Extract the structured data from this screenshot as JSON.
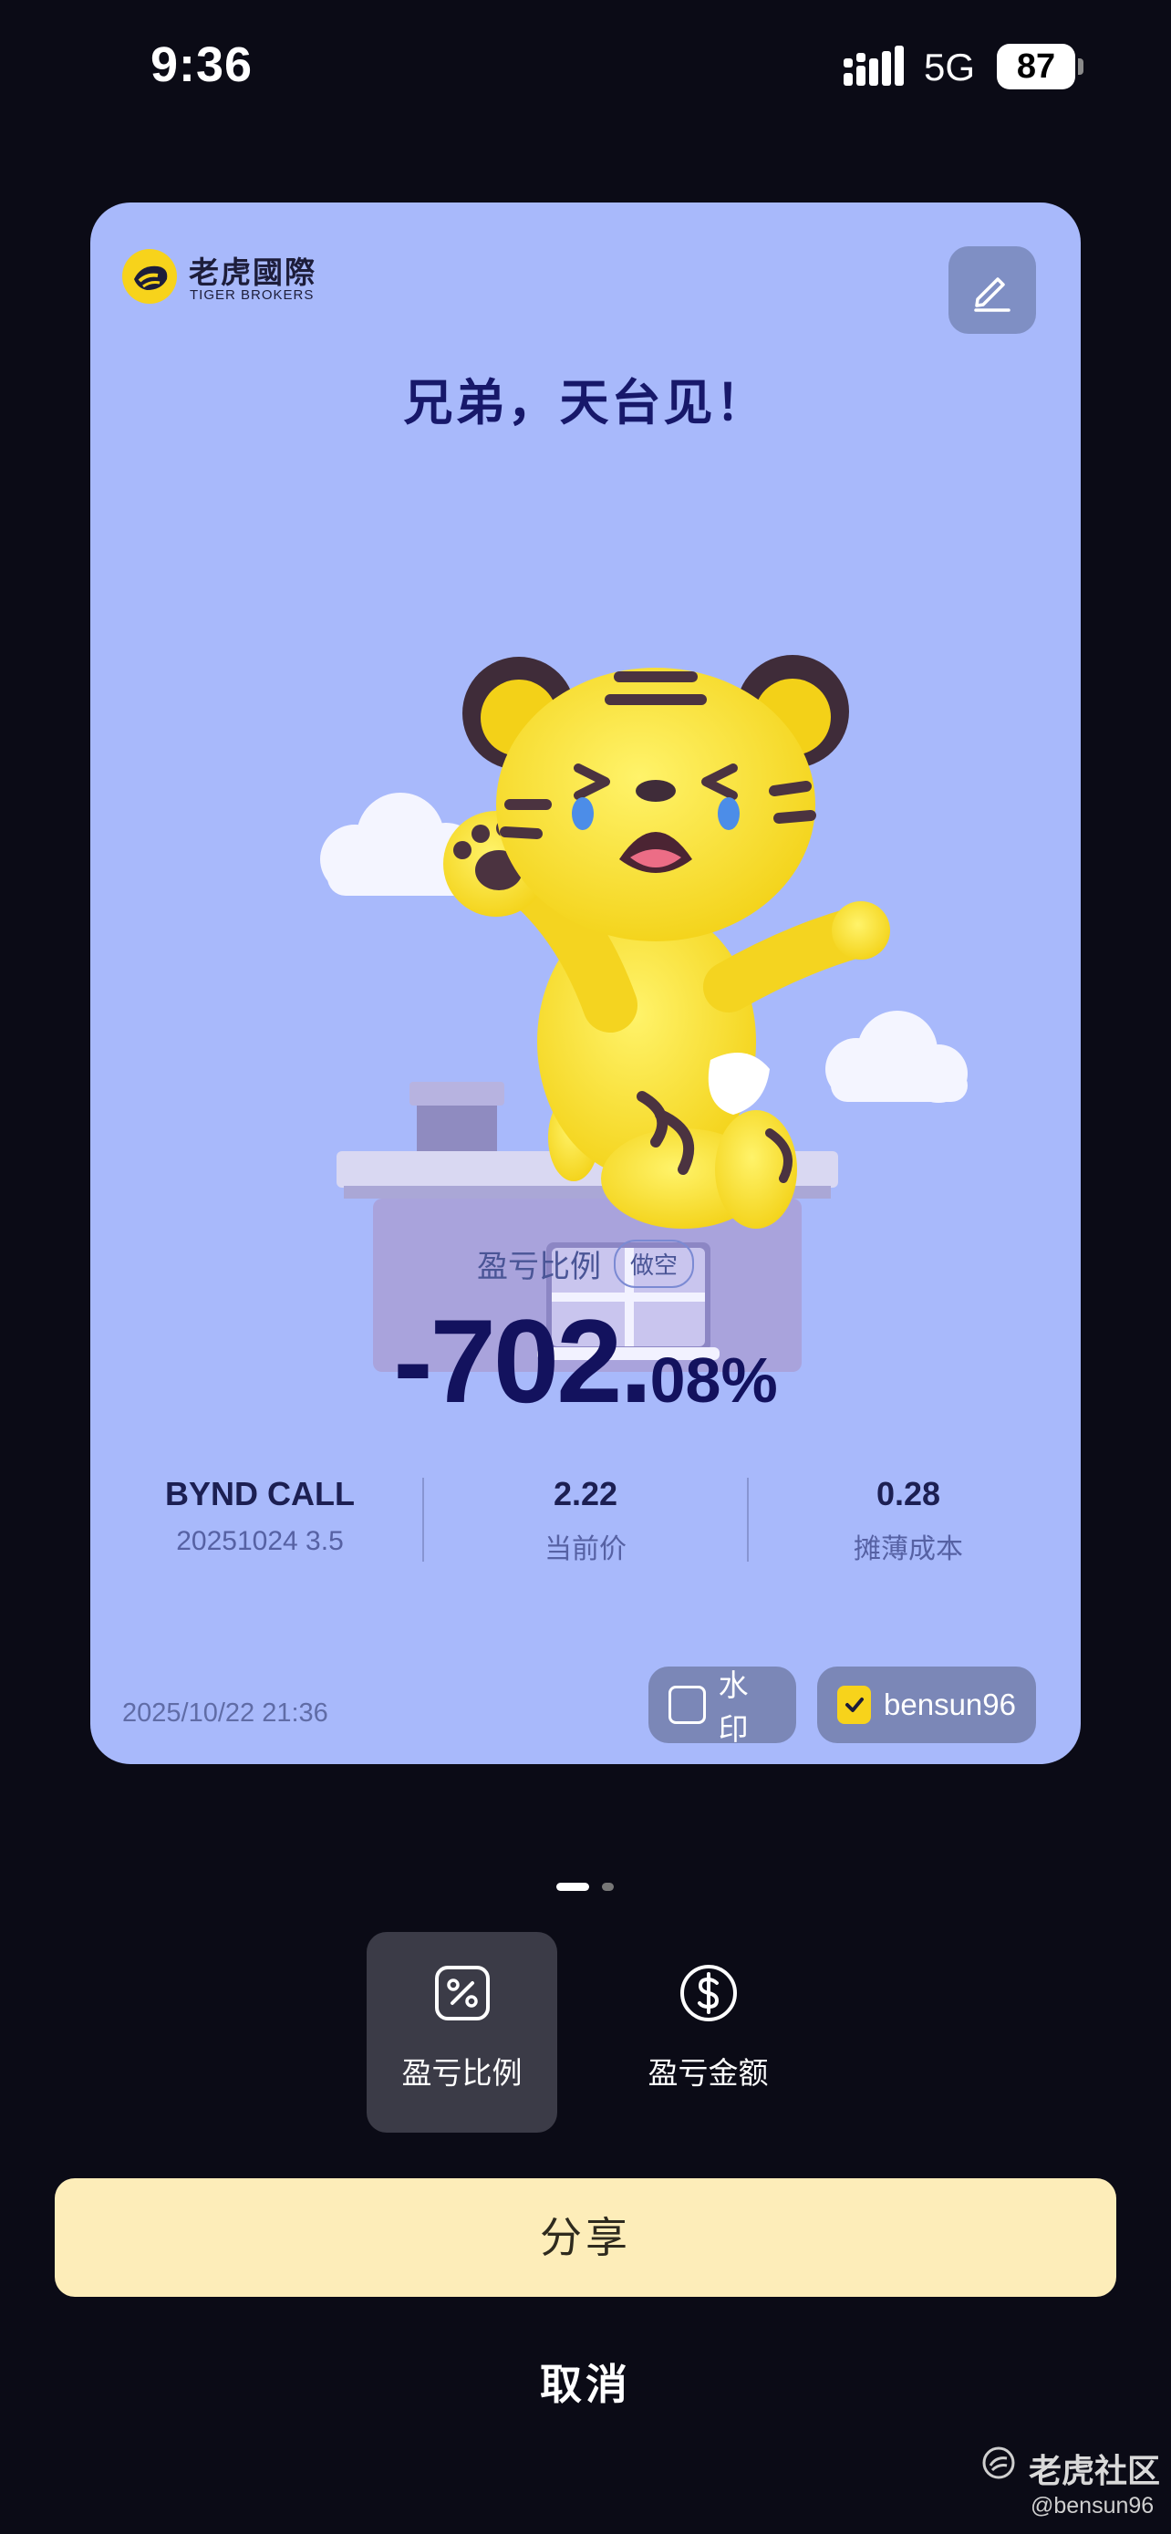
{
  "status_bar": {
    "time": "9:36",
    "network": "5G",
    "battery": "87"
  },
  "card": {
    "logo_cn": "老虎國際",
    "logo_en": "TIGER BROKERS",
    "headline": "兄弟，天台见！",
    "pl_label": "盈亏比例",
    "pl_badge": "做空",
    "pl_value_main": "-702.",
    "pl_value_sub": "08%",
    "stats": [
      {
        "top": "BYND CALL",
        "bottom": "20251024  3.5"
      },
      {
        "top": "2.22",
        "bottom": "当前价"
      },
      {
        "top": "0.28",
        "bottom": "摊薄成本"
      }
    ],
    "date": "2025/10/22 21:36",
    "watermark_label": "水印",
    "watermark_checked": false,
    "username_label": "bensun96",
    "username_checked": true
  },
  "pager": {
    "pages": 2,
    "current": 1
  },
  "tabs": [
    {
      "label": "盈亏比例",
      "icon": "percent-icon",
      "active": true
    },
    {
      "label": "盈亏金额",
      "icon": "dollar-icon",
      "active": false
    }
  ],
  "share_label": "分享",
  "cancel_label": "取消",
  "watermark": {
    "brand": "老虎社区",
    "user": "@bensun96"
  },
  "colors": {
    "card_bg": "#a8b9fb",
    "share_bg": "#fdedb9",
    "accent_yellow": "#f7d31b",
    "value_color": "#13125e"
  }
}
